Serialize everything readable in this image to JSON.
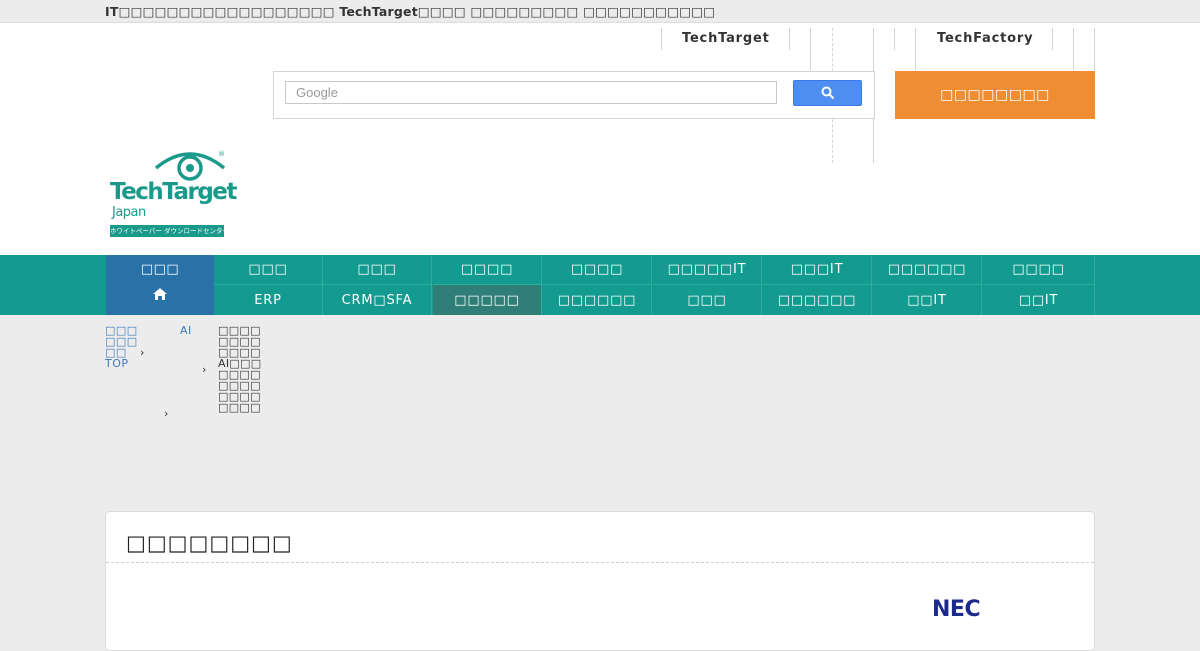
{
  "topbar": {
    "text": "IT□□□□□□□□□□□□□□□□□□ TechTarget□□□□ □□□□□□□□□ □□□□□□□□□□□"
  },
  "header": {
    "links": [
      "TechTarget",
      "TechFactory"
    ],
    "search": {
      "placeholder": "Google"
    },
    "orange_button": "□□□□□□□□",
    "logo": {
      "line1": "TechTarget",
      "line2": "Japan",
      "band": "ホワイトペーパー ダウンロードセンター",
      "registered": "®"
    }
  },
  "nav": {
    "home_label": "□□□",
    "row1": [
      "□□□",
      "□□□",
      "□□□□",
      "□□□□",
      "□□□□□IT",
      "□□□IT",
      "□□□□□□",
      "□□□□"
    ],
    "row2": [
      "ERP",
      "CRM□SFA",
      "□□□□□",
      "□□□□□□",
      "□□□",
      "□□□□□□",
      "□□IT",
      "□□IT"
    ],
    "active_row2_index": 2
  },
  "breadcrumb": {
    "root_lines": [
      "□□□",
      "□□□",
      "□□",
      "TOP"
    ],
    "ai_label": "AI",
    "sub_items": [
      "□□□□",
      "□□□□",
      "□□□□",
      "AI□□□",
      "□□□□",
      "□□□□",
      "□□□□",
      "□□□□"
    ],
    "arrow": "›"
  },
  "card": {
    "title": "□□□□□□□□",
    "vendor_logo": "NEC"
  },
  "colors": {
    "teal": "#139b8f",
    "home_blue": "#2872a8",
    "orange": "#ef8d32",
    "search_blue": "#4e8ef0"
  }
}
